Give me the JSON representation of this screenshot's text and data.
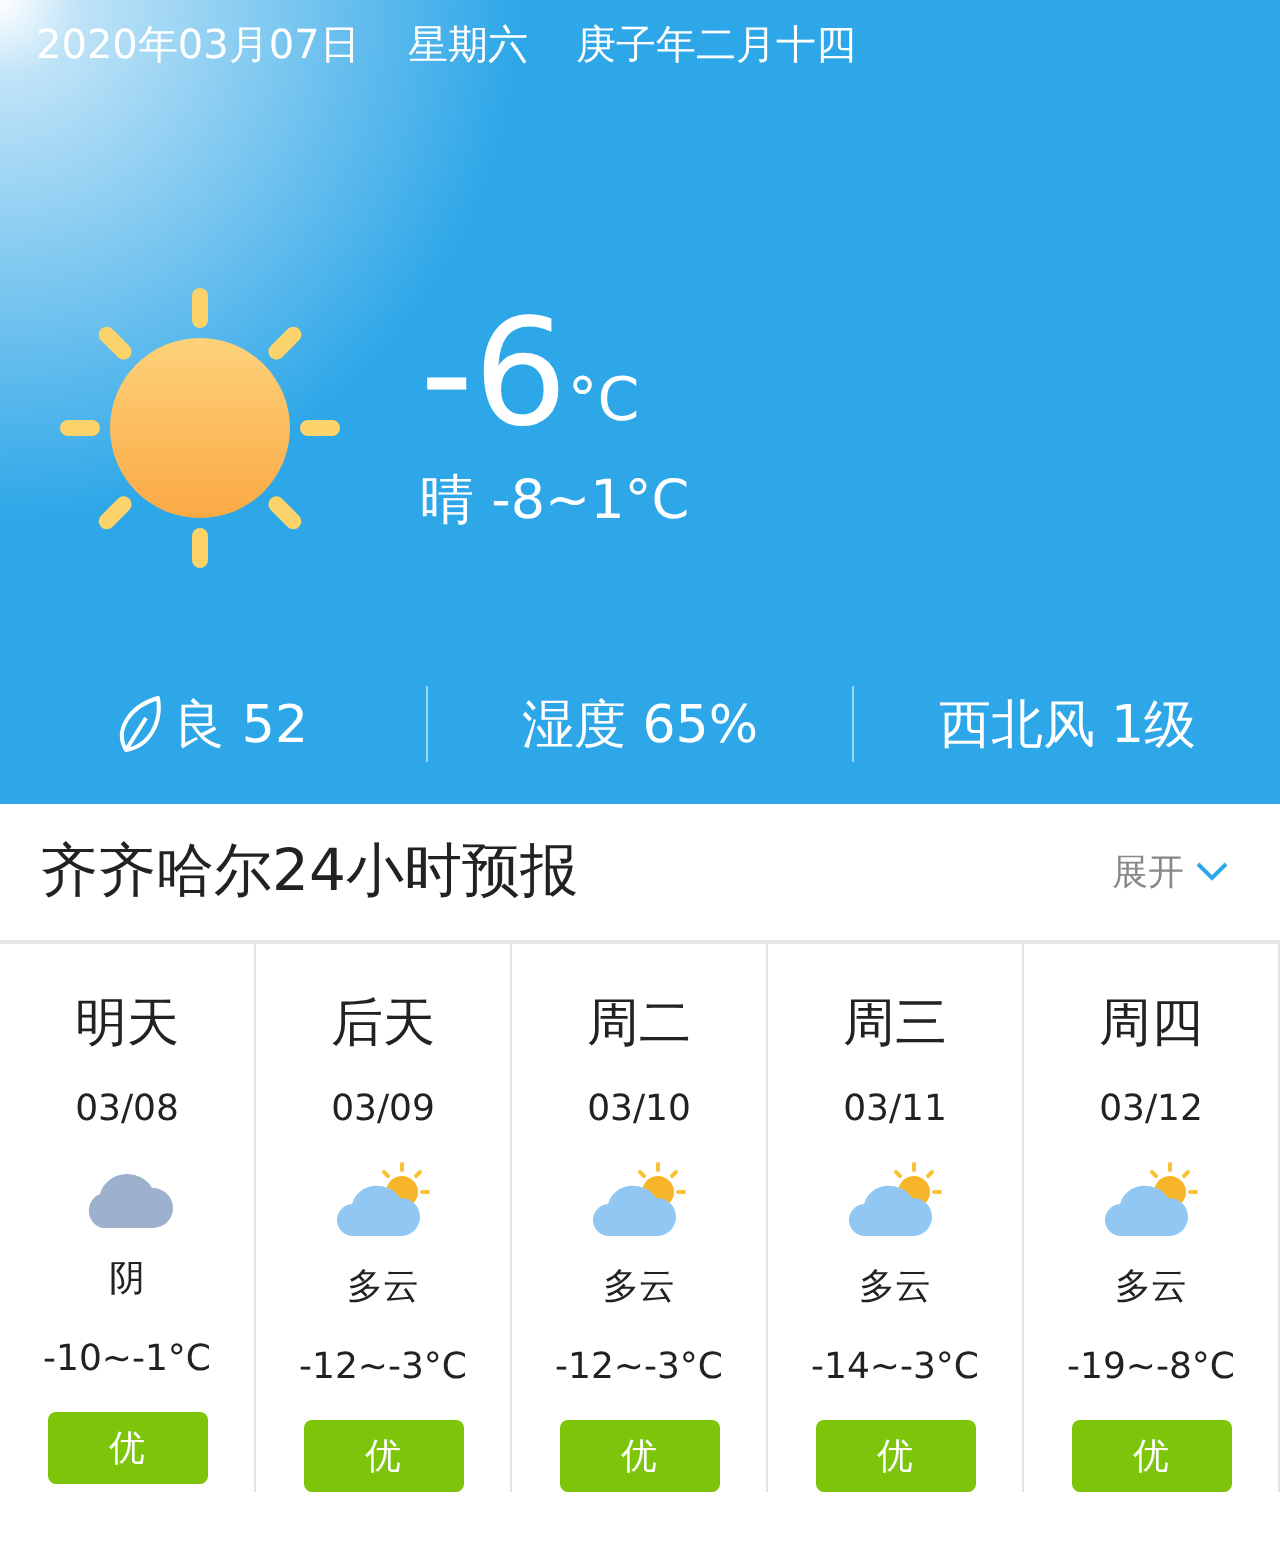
{
  "header": {
    "date": "2020年03月07日",
    "weekday": "星期六",
    "lunar": "庚子年二月十四",
    "temperature": "-6",
    "unit": "°C",
    "summary": "晴 -8~1°C",
    "stats": [
      {
        "kind": "aqi",
        "text": "良 52"
      },
      {
        "kind": "plain",
        "text": "湿度 65%"
      },
      {
        "kind": "plain",
        "text": "西北风 1级"
      }
    ]
  },
  "forecast": {
    "title": "齐齐哈尔24小时预报",
    "toggle": "展开",
    "days": [
      {
        "day": "明天",
        "date": "03/08",
        "kind": "overcast",
        "condition": "阴",
        "range": "-10~-1°C",
        "aqi": "优"
      },
      {
        "day": "后天",
        "date": "03/09",
        "kind": "partly_cloudy",
        "condition": "多云",
        "range": "-12~-3°C",
        "aqi": "优"
      },
      {
        "day": "周二",
        "date": "03/10",
        "kind": "partly_cloudy",
        "condition": "多云",
        "range": "-12~-3°C",
        "aqi": "优"
      },
      {
        "day": "周三",
        "date": "03/11",
        "kind": "partly_cloudy",
        "condition": "多云",
        "range": "-14~-3°C",
        "aqi": "优"
      },
      {
        "day": "周四",
        "date": "03/12",
        "kind": "partly_cloudy",
        "condition": "多云",
        "range": "-19~-8°C",
        "aqi": "优"
      }
    ]
  }
}
